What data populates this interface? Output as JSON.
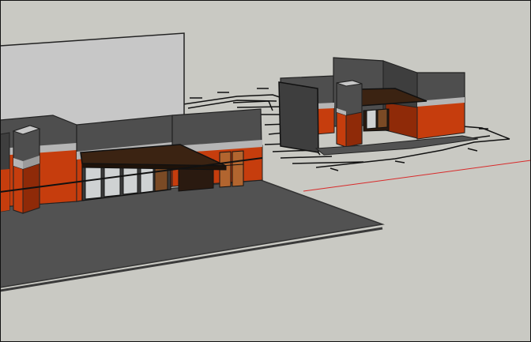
{
  "app": {
    "kind": "3d-modeling-viewport",
    "view": "perspective",
    "background_color": "#c9c9c3"
  },
  "scene": {
    "objects": [
      "ground-plane",
      "main-building",
      "entrance-canopy",
      "storefront-windows",
      "tower-column",
      "secondary-building",
      "secondary-tower",
      "secondary-canopy",
      "floor-plan-outline"
    ],
    "colors": {
      "ground": "#525252",
      "ground_edge": "#3a3a3a",
      "wall_light": "#c7c7c7",
      "wall_dark": "#4e4e4e",
      "wall_darker": "#3e3e3e",
      "accent_orange": "#c63d0d",
      "accent_orange_dark": "#8f2a08",
      "trim_band": "#b5b5b5",
      "canopy": "#3b2312",
      "door_wood": "#b2652f",
      "glass": "#cfd2d3",
      "axis_red": "#d82a2a"
    }
  }
}
